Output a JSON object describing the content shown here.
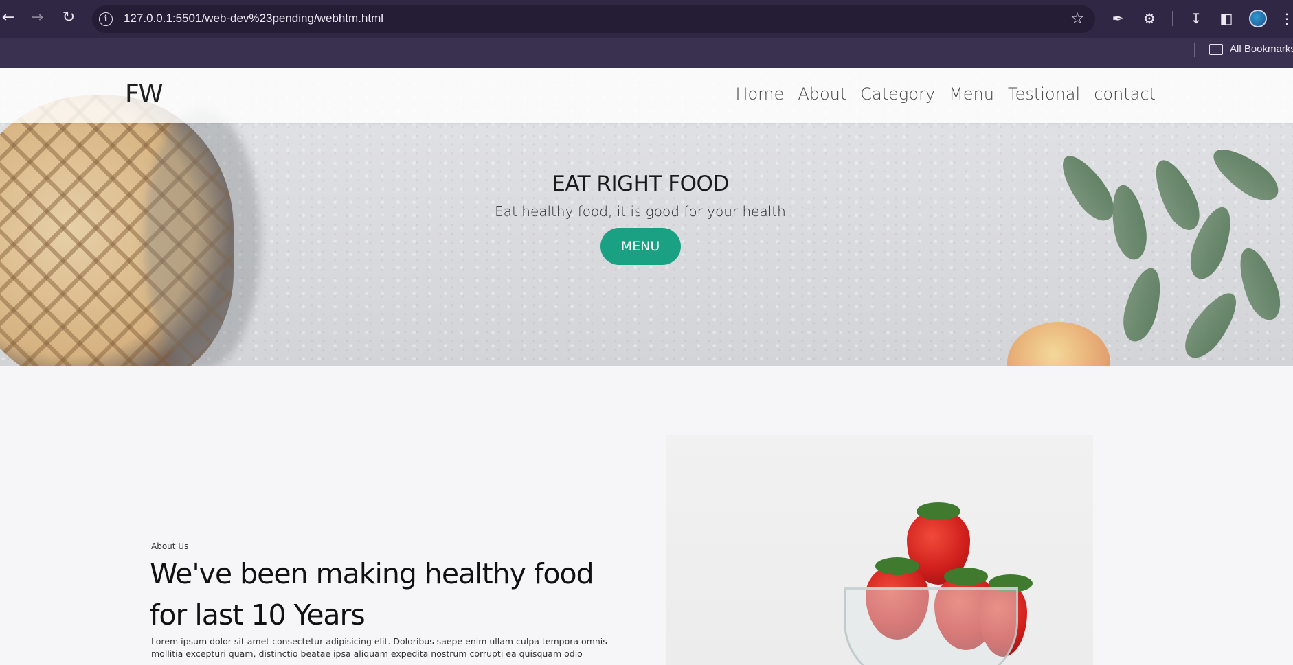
{
  "browser": {
    "url": "127.0.0.1:5501/web-dev%23pending/webhtm.html",
    "bookmarks_label": "All Bookmarks",
    "icons": [
      "back-icon",
      "forward-icon",
      "reload-icon",
      "site-info-icon",
      "star-icon",
      "eyedropper-icon",
      "extensions-icon",
      "download-icon",
      "side-panel-icon",
      "profile-avatar",
      "more-icon",
      "folder-icon"
    ]
  },
  "site": {
    "brand": "FW",
    "nav": [
      "Home",
      "About",
      "Category",
      "Menu",
      "Testional",
      "contact"
    ]
  },
  "hero": {
    "title": "EAT RIGHT FOOD",
    "subtitle": "Eat healthy food, it is good for your health",
    "button": "MENU",
    "accent_color": "#1aa184"
  },
  "about": {
    "kicker": "About Us",
    "heading": "We've been making healthy food for last 10 Years",
    "body": "Lorem ipsum dolor sit amet consectetur adipisicing elit. Doloribus saepe enim ullam culpa tempora omnis mollitia excepturi quam, distinctio beatae ipsa aliquam expedita nostrum corrupti ea quisquam odio"
  }
}
